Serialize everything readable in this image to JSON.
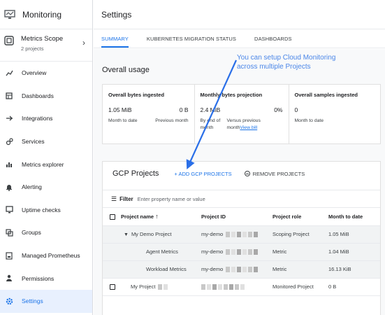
{
  "sidebar": {
    "app_title": "Monitoring",
    "scope": {
      "name": "Metrics Scope",
      "sub": "2 projects"
    },
    "items": [
      {
        "label": "Overview",
        "icon": "overview-icon"
      },
      {
        "label": "Dashboards",
        "icon": "dashboards-icon"
      },
      {
        "label": "Integrations",
        "icon": "integrations-icon"
      },
      {
        "label": "Services",
        "icon": "services-icon"
      },
      {
        "label": "Metrics explorer",
        "icon": "metrics-explorer-icon"
      },
      {
        "label": "Alerting",
        "icon": "bell-icon"
      },
      {
        "label": "Uptime checks",
        "icon": "uptime-icon"
      },
      {
        "label": "Groups",
        "icon": "groups-icon"
      },
      {
        "label": "Managed Prometheus",
        "icon": "prometheus-icon"
      },
      {
        "label": "Permissions",
        "icon": "person-icon"
      },
      {
        "label": "Settings",
        "icon": "gear-icon"
      }
    ],
    "active_index": 10
  },
  "header": {
    "title": "Settings"
  },
  "tabs": [
    "SUMMARY",
    "KUBERNETES MIGRATION STATUS",
    "DASHBOARDS"
  ],
  "annotation": {
    "line1": "You can setup Cloud Monitoring",
    "line2": "across multiple Projects"
  },
  "usage": {
    "title": "Overall usage",
    "cols": [
      {
        "title": "Overall bytes ingested",
        "value": "1.05 MiB",
        "right": "0 B",
        "sub_left": "Month to date",
        "sub_right": "Previous month"
      },
      {
        "title": "Monthly bytes projection",
        "value": "2.4 MiB",
        "right": "0%",
        "sub_left": "By end of month",
        "sub_right": "Versus previous month",
        "link": "View bill"
      },
      {
        "title": "Overall samples ingested",
        "value": "0",
        "sub_left": "Month to date"
      }
    ]
  },
  "projects": {
    "title": "GCP Projects",
    "add_label": "+ ADD GCP PROJECTS",
    "remove_label": "REMOVE PROJECTS",
    "filter_label": "Filter",
    "filter_placeholder": "Enter property name or value",
    "columns": [
      "Project name",
      "Project ID",
      "Project role",
      "Month to date"
    ],
    "rows": [
      {
        "name": "My Demo Project",
        "id": "my-demo",
        "role": "Scoping Project",
        "mtd": "1.05 MiB"
      },
      {
        "name": "Agent Metrics",
        "id": "my-demo",
        "role": "Metric",
        "mtd": "1.04 MiB"
      },
      {
        "name": "Workload Metrics",
        "id": "my-demo",
        "role": "Metric",
        "mtd": "16.13 KiB"
      },
      {
        "name": "My Project",
        "id": "",
        "role": "Monitored Project",
        "mtd": "0 B"
      }
    ]
  },
  "colors": {
    "accent": "#1a73e8",
    "annotation": "#4a86e8",
    "active_bg": "#e8f0fe"
  }
}
